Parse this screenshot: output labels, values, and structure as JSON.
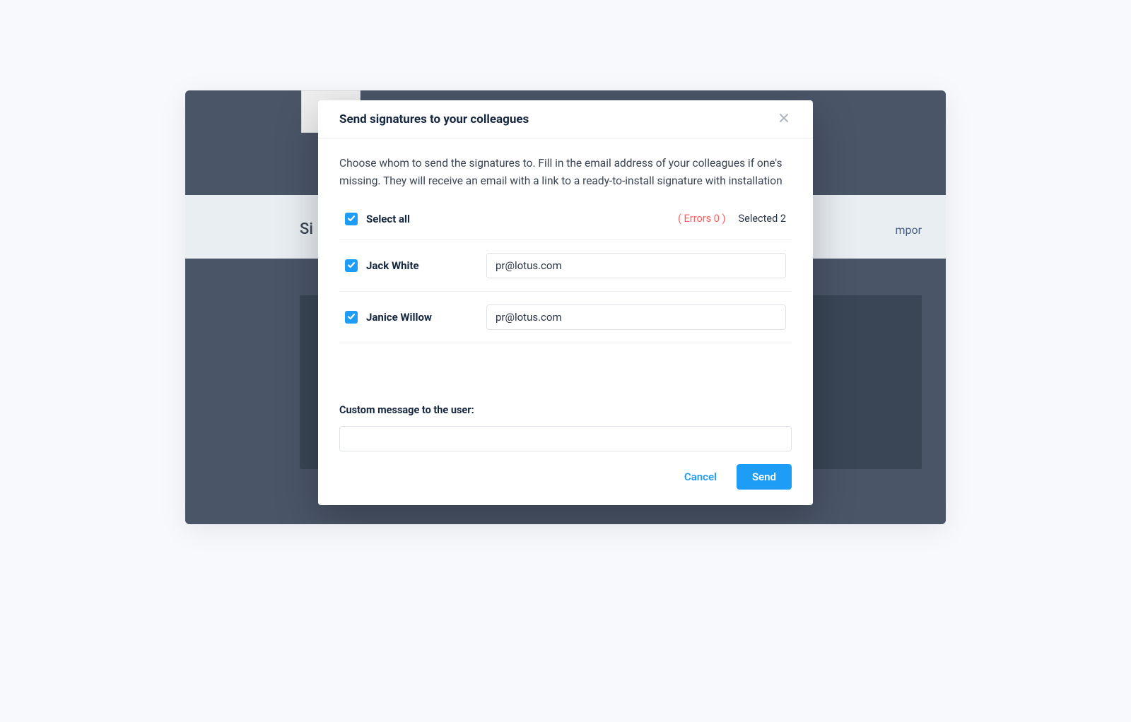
{
  "modal": {
    "title": "Send signatures to your colleagues",
    "description": "Choose whom to send the signatures to. Fill in the email address of your colleagues if one's missing. They will receive an email with a link to a ready-to-install signature with installation",
    "select_all_label": "Select all",
    "errors_label": "( Errors 0 )",
    "selected_label": "Selected 2",
    "recipients": [
      {
        "name": "Jack White",
        "email": "pr@lotus.com",
        "checked": true
      },
      {
        "name": "Janice Willow",
        "email": "pr@lotus.com",
        "checked": true
      }
    ],
    "custom_message_label": "Custom message to the user:",
    "custom_message_value": "",
    "cancel_label": "Cancel",
    "send_label": "Send"
  },
  "backdrop": {
    "left_text": "Si",
    "right_text": "mpor"
  },
  "colors": {
    "accent": "#1e9df7",
    "error": "#ff5b5b",
    "text_dark": "#15263f"
  }
}
